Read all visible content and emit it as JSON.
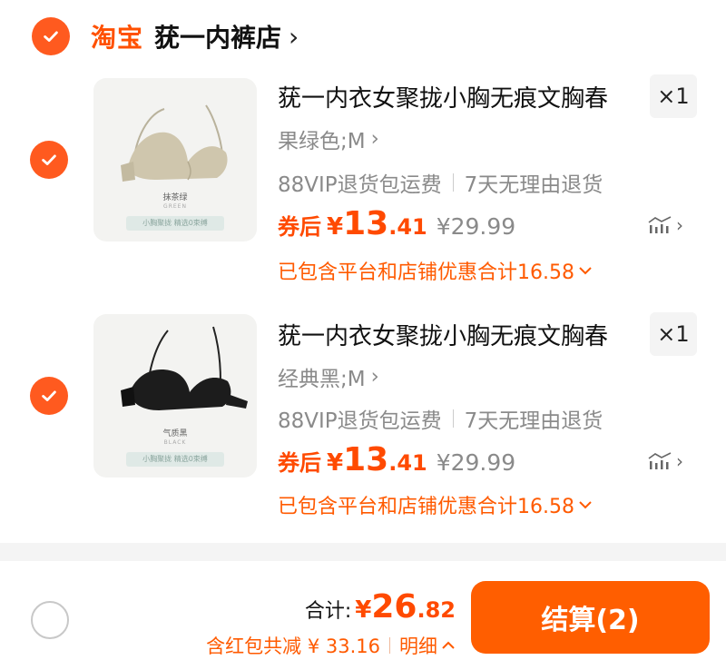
{
  "store": {
    "logo_text": "淘宝",
    "name": "莸一内裤店",
    "chevron": "›"
  },
  "items": [
    {
      "title": "莸一内衣女聚拢小胸无痕文胸春",
      "qty": "×1",
      "variant": "果绿色;M",
      "service_1": "88VIP退货包运费",
      "service_2": "7天无理由退货",
      "coupon_label": "券后",
      "price_yen": "¥",
      "price_int": "13",
      "price_dec": ".41",
      "original_price": "¥29.99",
      "discount_text": "已包含平台和店铺优惠合计16.58",
      "image": {
        "color_tag": "抹茶绿",
        "color_tag_en": "GREEN",
        "promo": "小胸聚拢 精选0束缚",
        "garment_color": "#cfc6ad"
      }
    },
    {
      "title": "莸一内衣女聚拢小胸无痕文胸春",
      "qty": "×1",
      "variant": "经典黑;M",
      "service_1": "88VIP退货包运费",
      "service_2": "7天无理由退货",
      "coupon_label": "券后",
      "price_yen": "¥",
      "price_int": "13",
      "price_dec": ".41",
      "original_price": "¥29.99",
      "discount_text": "已包含平台和店铺优惠合计16.58",
      "image": {
        "color_tag": "气质黑",
        "color_tag_en": "BLACK",
        "promo": "小胸聚拢 精选0束缚",
        "garment_color": "#1c1c1c"
      }
    }
  ],
  "footer": {
    "total_label": "合计:",
    "total_yen": "¥",
    "total_int": "26",
    "total_dec": ".82",
    "saving_text": "含红包共减 ¥ 33.16",
    "detail_label": "明细",
    "checkout_label": "结算(2)"
  },
  "colors": {
    "accent": "#ff5a1f",
    "price": "#ff4a00",
    "checkout": "#ff5e00"
  },
  "icons": {
    "check": "check-icon",
    "price_trend": "price-trend-icon",
    "chevron_right": "chevron-right-icon",
    "chevron_down": "chevron-down-icon",
    "chevron_up": "chevron-up-icon"
  }
}
